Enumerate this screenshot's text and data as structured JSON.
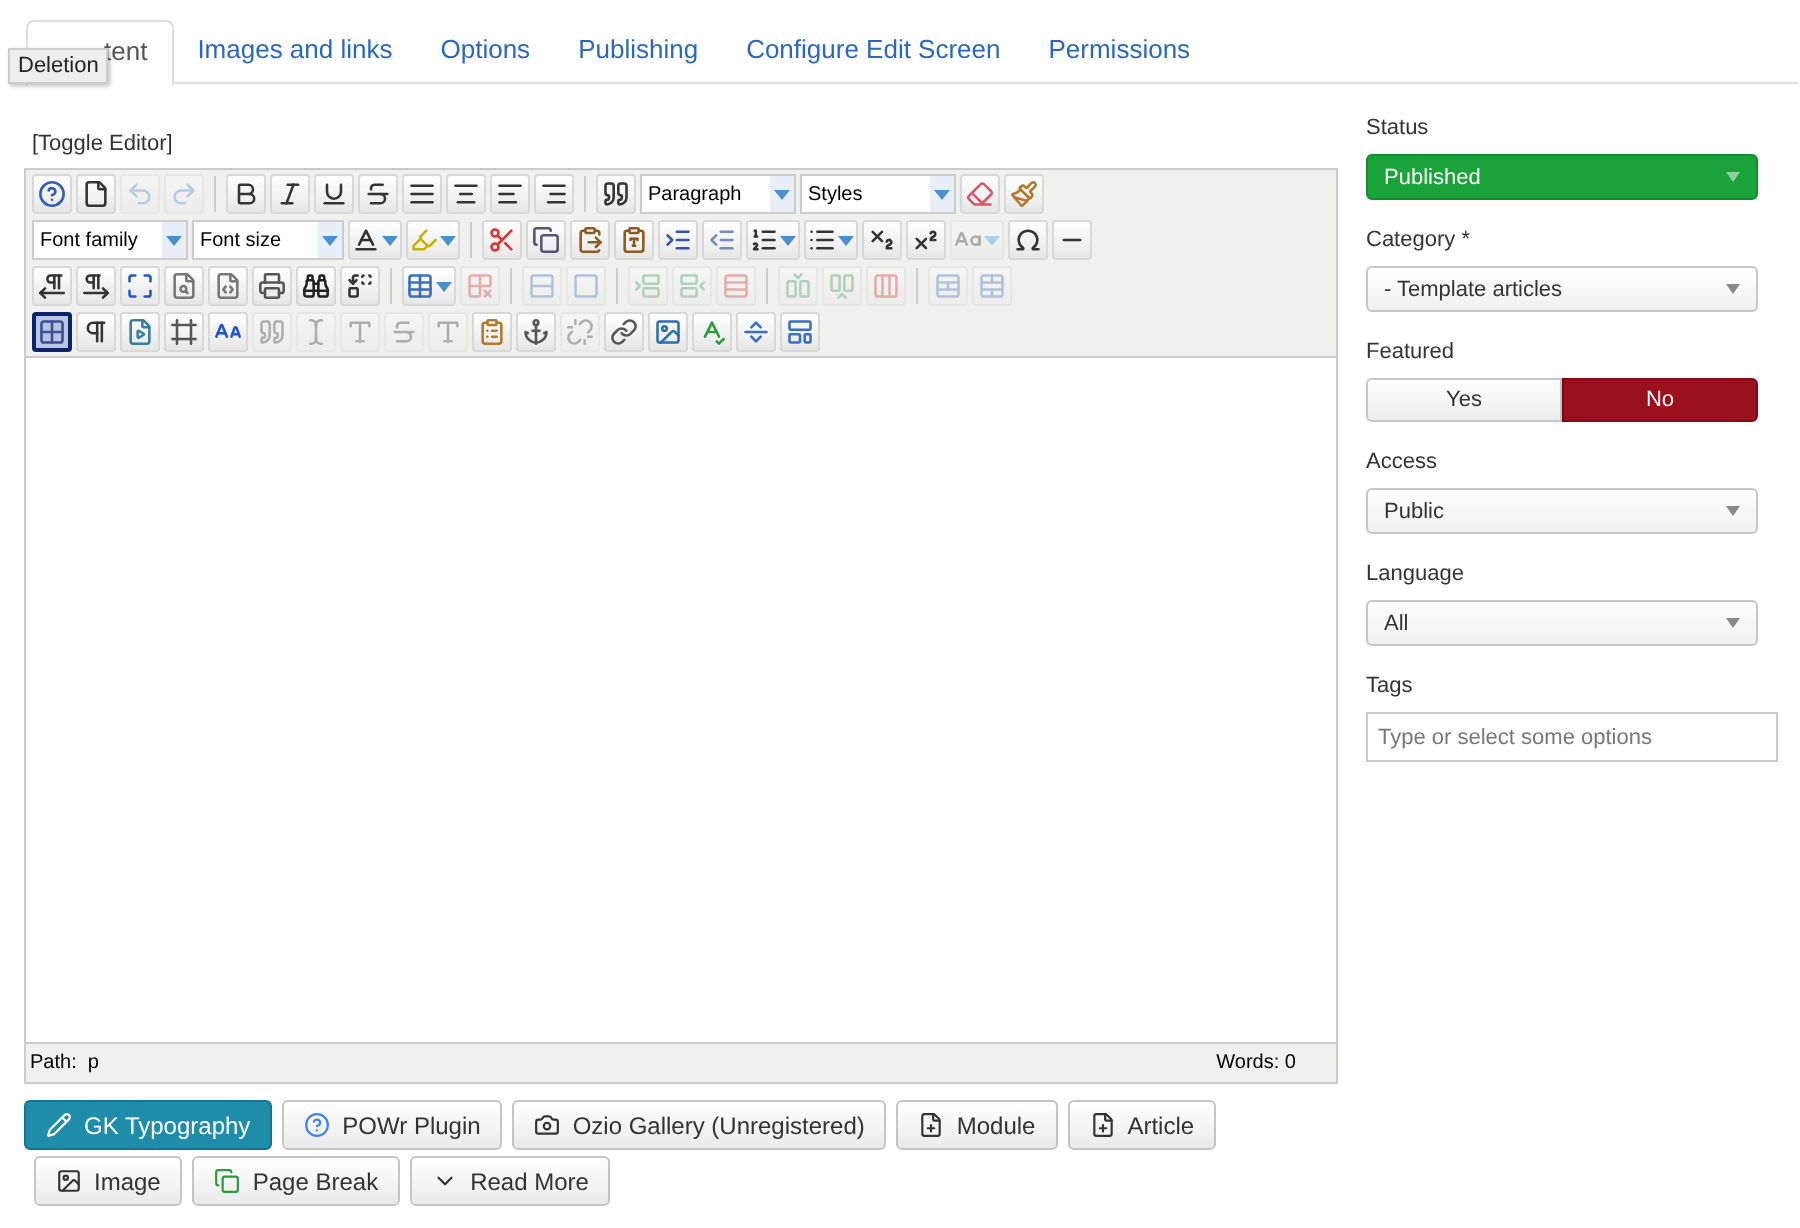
{
  "tabs": [
    {
      "label": "tent",
      "selected": true
    },
    {
      "label": "Images and links",
      "selected": false
    },
    {
      "label": "Options",
      "selected": false
    },
    {
      "label": "Publishing",
      "selected": false
    },
    {
      "label": "Configure Edit Screen",
      "selected": false
    },
    {
      "label": "Permissions",
      "selected": false
    }
  ],
  "tooltip": {
    "text": "Deletion"
  },
  "editor": {
    "toggle_label": "[Toggle Editor]",
    "toolbar": {
      "rows": [
        [
          {
            "kind": "button",
            "disabled": false
          },
          {
            "kind": "button",
            "disabled": false
          },
          {
            "kind": "button",
            "disabled": true
          },
          {
            "kind": "button",
            "disabled": true
          },
          {
            "kind": "separator"
          },
          {
            "kind": "button",
            "disabled": false
          },
          {
            "kind": "button",
            "disabled": false
          },
          {
            "kind": "button",
            "disabled": false
          },
          {
            "kind": "button",
            "disabled": false
          },
          {
            "kind": "button",
            "disabled": false
          },
          {
            "kind": "button",
            "disabled": false
          },
          {
            "kind": "button",
            "disabled": false
          },
          {
            "kind": "button",
            "disabled": false
          },
          {
            "kind": "separator"
          },
          {
            "kind": "button",
            "disabled": false
          },
          {
            "kind": "select",
            "label": "Paragraph"
          },
          {
            "kind": "select",
            "label": "Styles"
          },
          {
            "kind": "button",
            "disabled": false
          },
          {
            "kind": "button",
            "disabled": false
          }
        ],
        [
          {
            "kind": "select",
            "label": "Font family"
          },
          {
            "kind": "select",
            "label": "Font size"
          },
          {
            "kind": "split",
            "disabled": false
          },
          {
            "kind": "split",
            "disabled": false
          },
          {
            "kind": "separator"
          },
          {
            "kind": "button",
            "disabled": false
          },
          {
            "kind": "button",
            "disabled": false
          },
          {
            "kind": "button",
            "disabled": false
          },
          {
            "kind": "button",
            "disabled": false
          },
          {
            "kind": "button",
            "disabled": false
          },
          {
            "kind": "button",
            "disabled": false
          },
          {
            "kind": "split",
            "disabled": false
          },
          {
            "kind": "split",
            "disabled": false
          },
          {
            "kind": "button",
            "disabled": false
          },
          {
            "kind": "button",
            "disabled": false
          },
          {
            "kind": "split",
            "disabled": true
          },
          {
            "kind": "button",
            "disabled": false
          },
          {
            "kind": "button",
            "disabled": false
          }
        ],
        [
          {
            "kind": "button",
            "disabled": false
          },
          {
            "kind": "button",
            "disabled": false
          },
          {
            "kind": "button",
            "disabled": false
          },
          {
            "kind": "button",
            "disabled": false
          },
          {
            "kind": "button",
            "disabled": false
          },
          {
            "kind": "button",
            "disabled": false
          },
          {
            "kind": "button",
            "disabled": false
          },
          {
            "kind": "button",
            "disabled": false
          },
          {
            "kind": "separator"
          },
          {
            "kind": "split",
            "disabled": false
          },
          {
            "kind": "button",
            "disabled": true
          },
          {
            "kind": "separator"
          },
          {
            "kind": "button",
            "disabled": true
          },
          {
            "kind": "button",
            "disabled": true
          },
          {
            "kind": "separator"
          },
          {
            "kind": "button",
            "disabled": true
          },
          {
            "kind": "button",
            "disabled": true
          },
          {
            "kind": "button",
            "disabled": true
          },
          {
            "kind": "separator"
          },
          {
            "kind": "button",
            "disabled": true
          },
          {
            "kind": "button",
            "disabled": true
          },
          {
            "kind": "button",
            "disabled": true
          },
          {
            "kind": "separator"
          },
          {
            "kind": "button",
            "disabled": true
          },
          {
            "kind": "button",
            "disabled": true
          }
        ],
        [
          {
            "kind": "active_button",
            "disabled": false
          },
          {
            "kind": "button",
            "disabled": false
          },
          {
            "kind": "button",
            "disabled": false
          },
          {
            "kind": "button",
            "disabled": false
          },
          {
            "kind": "button",
            "disabled": false
          },
          {
            "kind": "button",
            "disabled": true
          },
          {
            "kind": "button",
            "disabled": true
          },
          {
            "kind": "button",
            "disabled": true
          },
          {
            "kind": "button",
            "disabled": true
          },
          {
            "kind": "button",
            "disabled": true
          },
          {
            "kind": "button",
            "disabled": false
          },
          {
            "kind": "button",
            "disabled": false
          },
          {
            "kind": "button",
            "disabled": true
          },
          {
            "kind": "button",
            "disabled": false
          },
          {
            "kind": "button",
            "disabled": false
          },
          {
            "kind": "button",
            "disabled": false
          },
          {
            "kind": "button",
            "disabled": false
          },
          {
            "kind": "button",
            "disabled": false
          }
        ]
      ]
    },
    "path": "Path:  p",
    "words": "Words: 0"
  },
  "editor_buttons": [
    {
      "label": "GK Typography",
      "primary": true
    },
    {
      "label": "POWr Plugin",
      "primary": false
    },
    {
      "label": "Ozio Gallery (Unregistered)",
      "primary": false
    },
    {
      "label": "Module",
      "primary": false
    },
    {
      "label": "Article",
      "primary": false
    },
    {
      "label": "Image",
      "primary": false
    },
    {
      "label": "Page Break",
      "primary": false
    },
    {
      "label": "Read More",
      "primary": false
    }
  ],
  "sidebar": {
    "fields": [
      {
        "label": "Status",
        "kind": "status_select",
        "value": "Published"
      },
      {
        "label": "Category *",
        "kind": "select",
        "value": "- Template articles"
      },
      {
        "label": "Featured",
        "kind": "toggle",
        "options": [
          {
            "label": "Yes",
            "selected": false
          },
          {
            "label": "No",
            "selected": true
          }
        ]
      },
      {
        "label": "Access",
        "kind": "select",
        "value": "Public"
      },
      {
        "label": "Language",
        "kind": "select",
        "value": "All"
      },
      {
        "label": "Tags",
        "kind": "tags",
        "placeholder": "Type or select some options"
      }
    ]
  }
}
